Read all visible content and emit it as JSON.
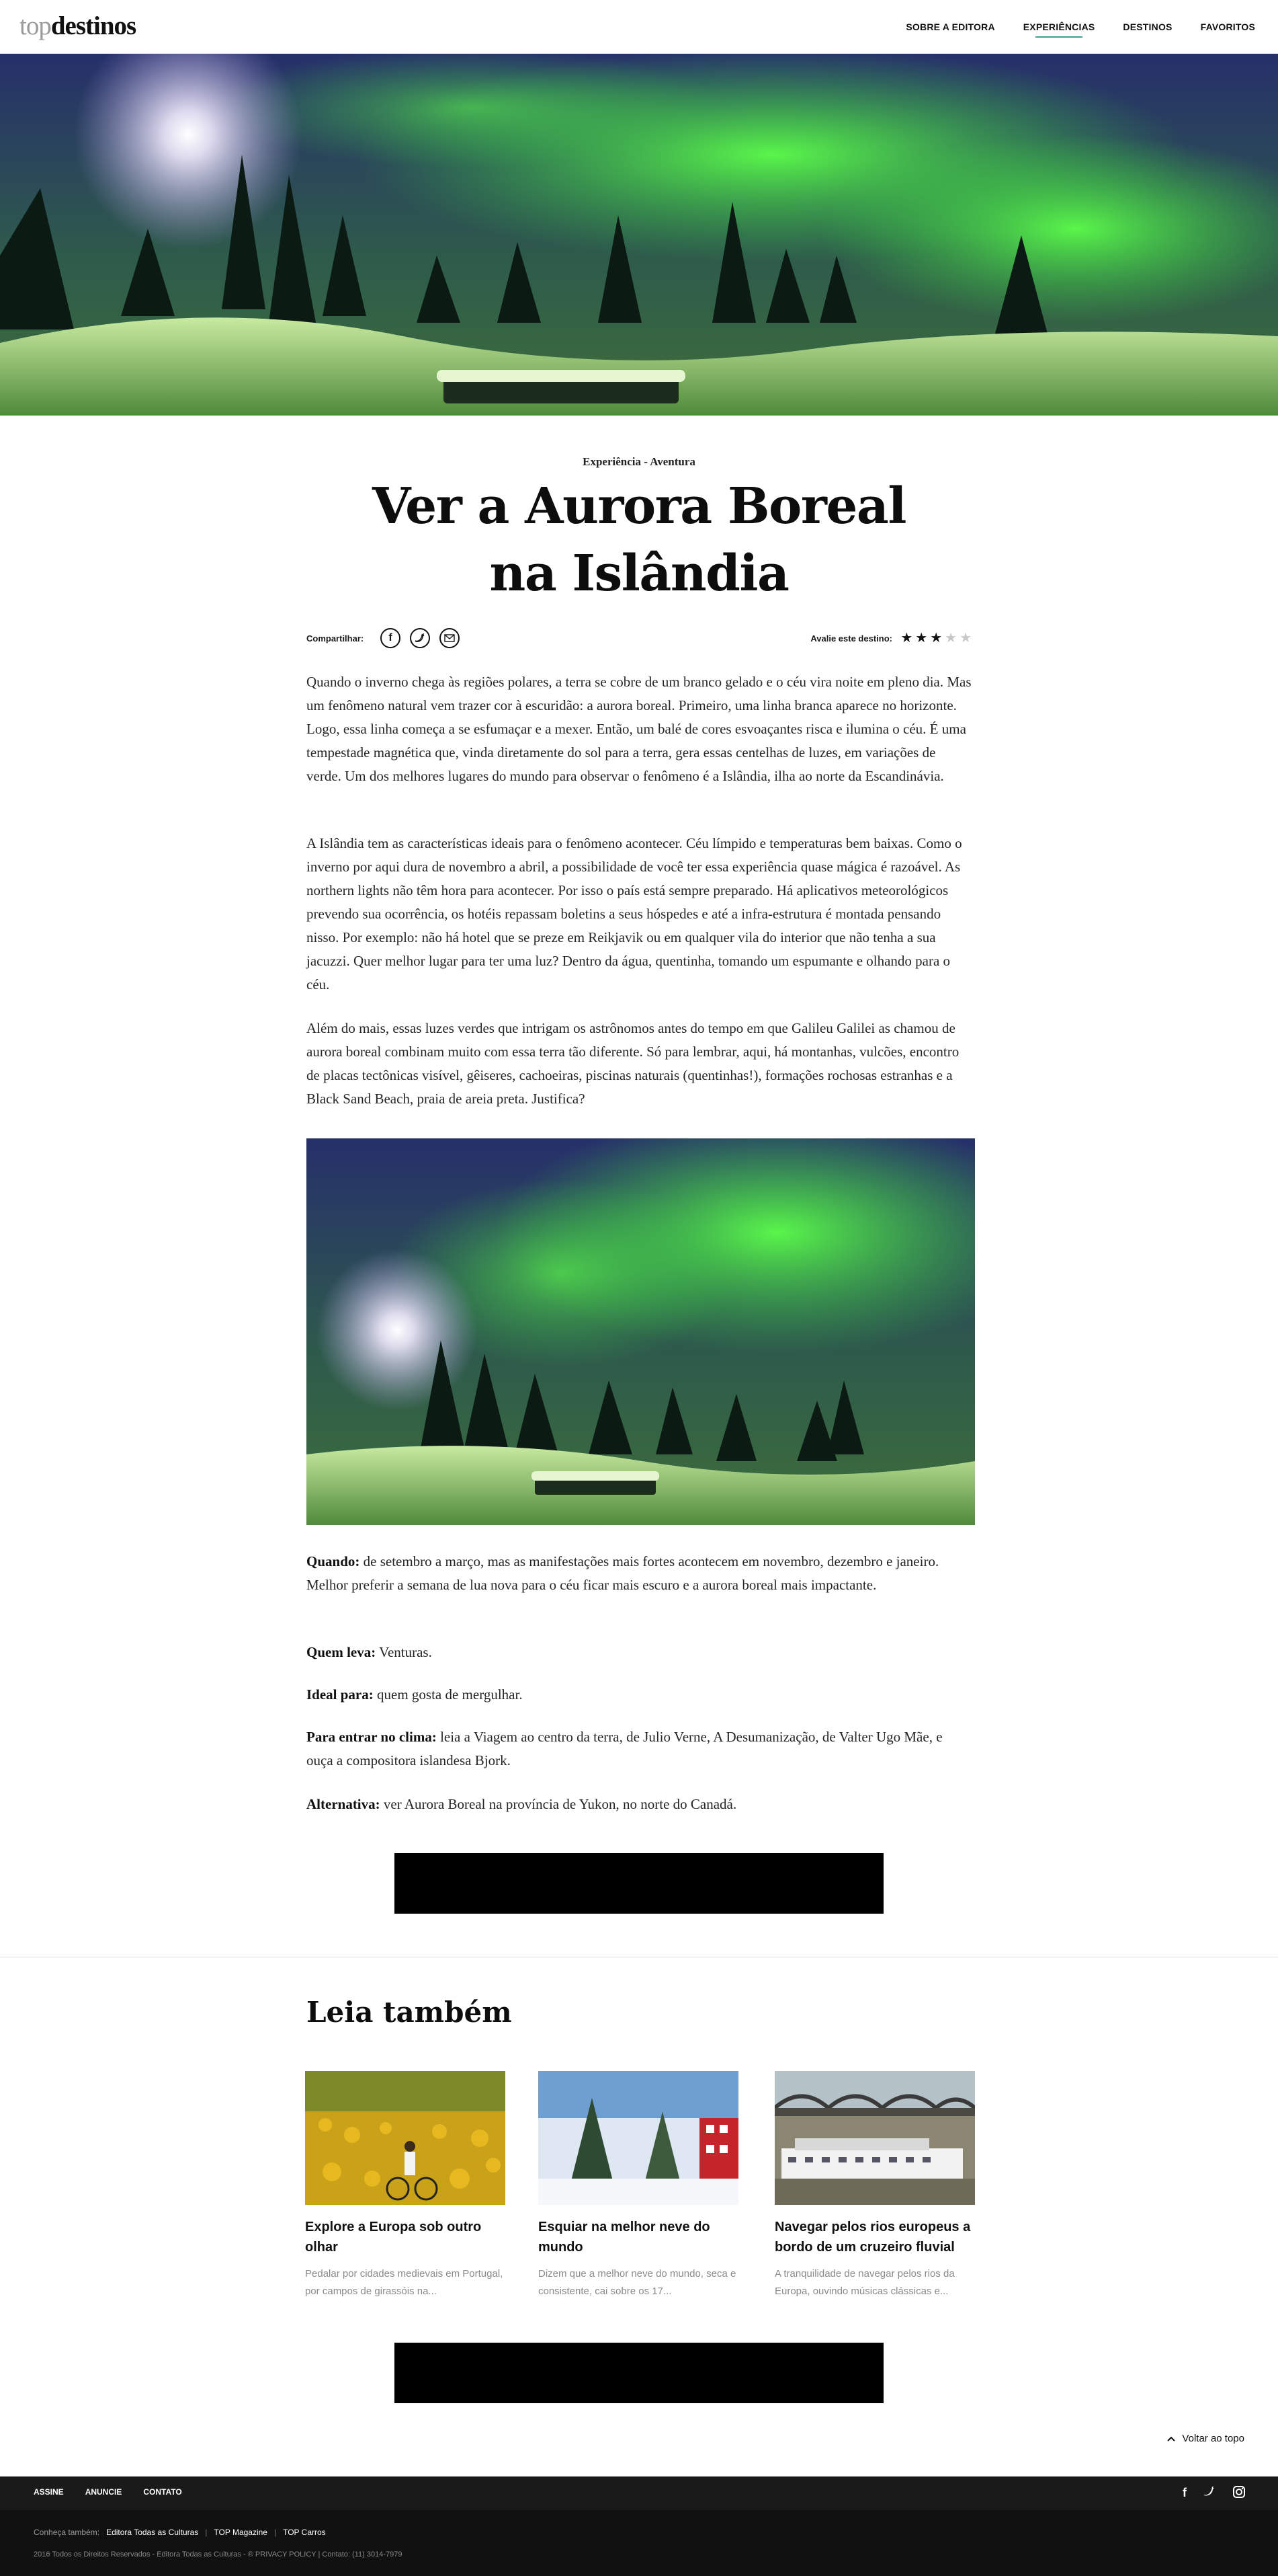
{
  "header": {
    "logo_light": "top",
    "logo_bold": "destinos",
    "nav": [
      "SOBRE A EDITORA",
      "EXPERIÊNCIAS",
      "DESTINOS",
      "FAVORITOS"
    ]
  },
  "article": {
    "category": "Experiência - Aventura",
    "title_line1": "Ver a Aurora Boreal",
    "title_line2": "na Islândia",
    "share_label": "Compartilhar:",
    "share_icons": [
      "facebook-icon",
      "twitter-icon",
      "email-icon"
    ],
    "rate_label": "Avalie este destino:",
    "rating": 3,
    "rating_max": 5,
    "paragraphs": [
      "Quando o inverno chega às regiões polares, a terra se cobre de um branco gelado e o céu vira noite em pleno dia. Mas um fenômeno natural vem trazer cor à escuridão: a aurora boreal. Primeiro, uma linha branca aparece no horizonte. Logo, essa linha começa a se esfumaçar e a mexer. Então, um balé de cores esvoaçantes risca e ilumina o céu. É uma tempestade magnética que, vinda diretamente do sol para a terra, gera essas centelhas de luzes, em variações de verde. Um dos melhores lugares do mundo para observar o fenômeno é a Islândia, ilha ao norte da Escandinávia.",
      "A Islândia tem as características ideais para o fenômeno acontecer. Céu límpido e temperaturas bem baixas. Como o inverno por aqui dura de novembro a abril, a possibilidade de você ter essa experiência quase mágica é razoável. As northern lights não têm hora para acontecer. Por isso o país está sempre preparado. Há aplicativos meteorológicos prevendo sua ocorrência, os hotéis repassam boletins a seus hóspedes e até a infra-estrutura é montada pensando nisso. Por exemplo: não há hotel que se preze em Reikjavik ou em qualquer vila do interior que não tenha a sua jacuzzi. Quer melhor lugar para ter uma luz? Dentro da água, quentinha, tomando um espumante e olhando para o céu.",
      "Além do mais, essas luzes verdes que intrigam os astrônomos antes do tempo em que Galileu Galilei as chamou de aurora boreal combinam muito com essa terra tão diferente. Só para lembrar, aqui, há montanhas, vulcões, encontro de placas tectônicas visível, gêiseres, cachoeiras, piscinas naturais (quentinhas!), formações rochosas estranhas e a Black Sand Beach, praia de areia preta. Justifica?"
    ],
    "facts": [
      {
        "label": "Quando:",
        "text": " de setembro a março, mas as manifestações mais fortes acontecem em novembro, dezembro e janeiro. Melhor preferir a semana de lua nova para o céu ficar mais escuro e a aurora boreal mais impactante."
      },
      {
        "label": "Quem leva:",
        "text": " Venturas."
      },
      {
        "label": "Ideal para:",
        "text": " quem gosta de mergulhar."
      },
      {
        "label": "Para entrar no clima:",
        "text": " leia a Viagem ao centro da terra, de Julio Verne, A Desumanização, de Valter Ugo Mãe, e ouça a compositora islandesa Bjork."
      },
      {
        "label": "Alternativa:",
        "text": " ver Aurora Boreal na província de Yukon, no norte do Canadá."
      }
    ]
  },
  "related": {
    "heading": "Leia também",
    "cards": [
      {
        "title": "Explore a Europa sob outro olhar",
        "excerpt": "Pedalar por cidades medievais em Portugal, por campos de girassóis na..."
      },
      {
        "title": "Esquiar na melhor neve do mundo",
        "excerpt": "Dizem que a melhor neve do mundo, seca e consistente, cai sobre os 17..."
      },
      {
        "title": "Navegar pelos rios europeus a bordo de um cruzeiro fluvial",
        "excerpt": "A tranquilidade de navegar pelos rios da Europa, ouvindo músicas clássicas e..."
      }
    ]
  },
  "back_to_top": "Voltar ao topo",
  "footer": {
    "links": [
      "ASSINE",
      "ANUNCIE",
      "CONTATO"
    ],
    "social": [
      "facebook-icon",
      "twitter-icon",
      "instagram-icon"
    ],
    "know_label": "Conheça também:",
    "know_links": [
      "Editora Todas as Culturas",
      "TOP Magazine",
      "TOP Carros"
    ],
    "copyright": "2016 Todos os Direitos Reservados - Editora Todas as Culturas - ® PRIVACY POLICY",
    "contact": "Contato: (11) 3014-7979"
  },
  "colors": {
    "accent": "#3b9f8f",
    "footer_dark": "#1a1a1a",
    "footer_darker": "#111111"
  }
}
